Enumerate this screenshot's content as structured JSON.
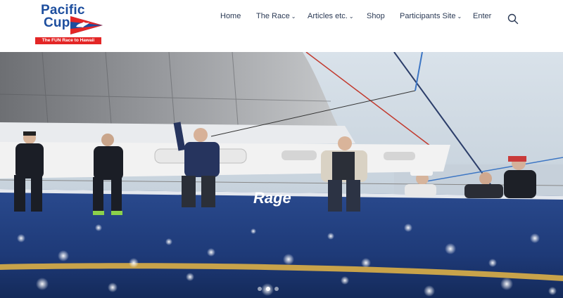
{
  "logo": {
    "title_line1": "Pacific",
    "title_line2": "Cup",
    "tagline": "The FUN Race to Hawaii"
  },
  "nav": {
    "items": [
      {
        "label": "Home",
        "has_dropdown": false
      },
      {
        "label": "The Race",
        "has_dropdown": true
      },
      {
        "label": "Articles etc.",
        "has_dropdown": true
      },
      {
        "label": "Shop",
        "has_dropdown": false
      },
      {
        "label": "Participants Site",
        "has_dropdown": true
      },
      {
        "label": "Enter",
        "has_dropdown": false
      }
    ],
    "chevron": "⌄",
    "search_icon": "search-icon"
  },
  "hero": {
    "boat_name": "Rage",
    "slider": {
      "count": 3,
      "active_index": 1
    }
  },
  "colors": {
    "brand_blue": "#1d4e9e",
    "brand_red": "#e32626",
    "hull_blue": "#1e3a78",
    "nav_text": "#2b3a55"
  }
}
